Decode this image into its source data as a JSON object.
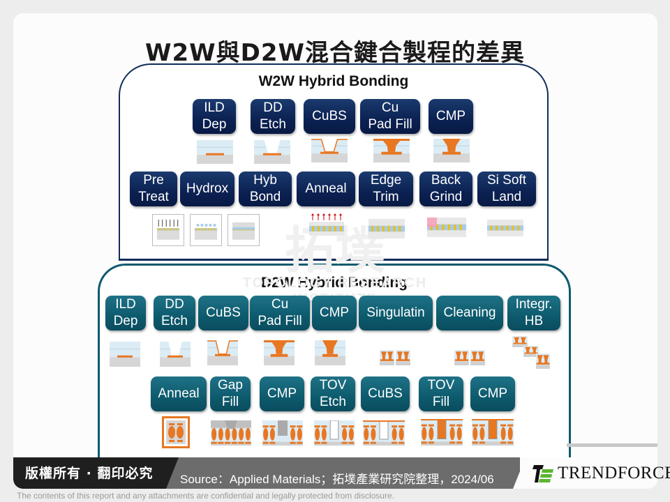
{
  "title": "W2W與D2W混合鍵合製程的差異",
  "watermark": {
    "main": "拓墣",
    "sub": "TOPOLOGY RESEARCH INSTITUTE"
  },
  "w2w": {
    "title": "W2W Hybrid Bonding",
    "row1": [
      "ILD\nDep",
      "DD\nEtch",
      "CuBS",
      "Cu\nPad Fill",
      "CMP"
    ],
    "row2": [
      "Pre\nTreat",
      "Hydrox",
      "Hyb\nBond",
      "Anneal",
      "Edge\nTrim",
      "Back\nGrind",
      "Si Soft\nLand"
    ]
  },
  "d2w": {
    "title": "D2W Hybrid Bonding",
    "row1": [
      "ILD\nDep",
      "DD\nEtch",
      "CuBS",
      "Cu\nPad Fill",
      "CMP",
      "Singulatin",
      "Cleaning",
      "Integr.\nHB"
    ],
    "row2": [
      "Anneal",
      "Gap\nFill",
      "CMP",
      "TOV\nEtch",
      "CuBS",
      "TOV\nFill",
      "CMP"
    ]
  },
  "colors": {
    "navy": "#0b2152",
    "teal": "#0d5a6d",
    "copper": "#e87722",
    "dielectric": "#dcecf5",
    "substrate": "#d6d6d6"
  },
  "footer": {
    "copyright": "版權所有 · 翻印必究",
    "source": "Source：Applied Materials；拓墣產業研究院整理，2024/06",
    "logo_text": "TRENDFORCE",
    "disclaimer": "The contents of this report and any attachments are confidential and legally protected from disclosure."
  }
}
